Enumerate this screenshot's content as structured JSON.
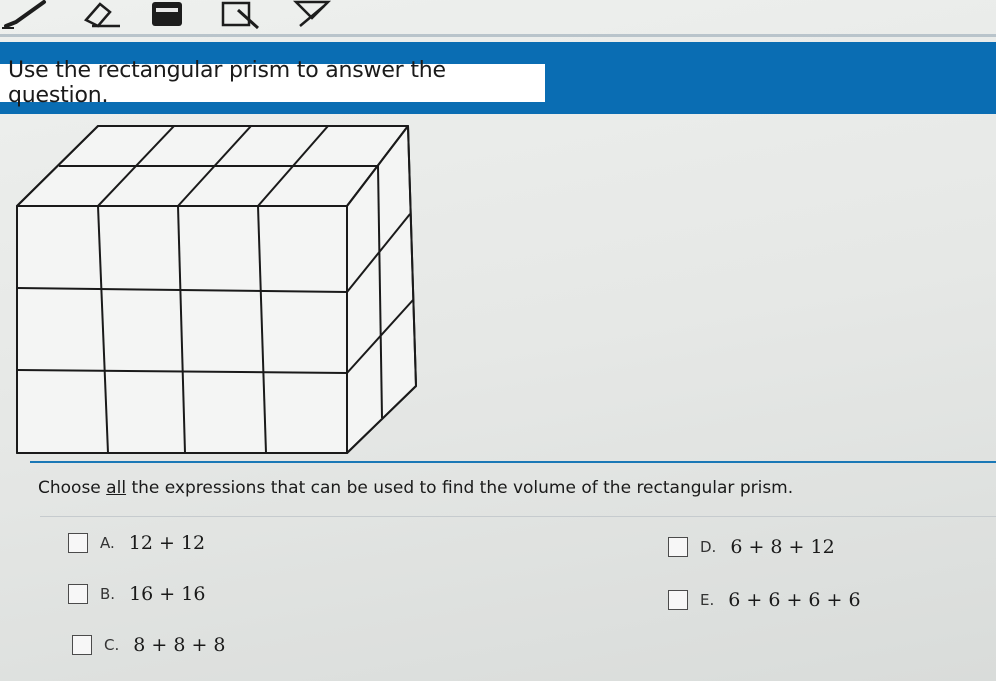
{
  "banner": {
    "title": "Use the rectangular prism to answer the question."
  },
  "question": {
    "prefix": "Choose ",
    "emphasis": "all",
    "suffix": " the expressions that can be used to find the volume of the rectangular prism."
  },
  "options": [
    {
      "letter": "A.",
      "expression": "12 + 12"
    },
    {
      "letter": "B.",
      "expression": "16 + 16"
    },
    {
      "letter": "C.",
      "expression": "8 + 8 + 8"
    },
    {
      "letter": "D.",
      "expression": "6 + 8 + 12"
    },
    {
      "letter": "E.",
      "expression": "6 + 6 + 6 + 6"
    }
  ],
  "toolbar": {
    "tools": [
      "pencil-icon",
      "eraser-icon",
      "calculator-icon",
      "notepad-icon",
      "reference-icon"
    ]
  },
  "colors": {
    "banner": "#0a6db3",
    "divider": "#1a78b6"
  }
}
